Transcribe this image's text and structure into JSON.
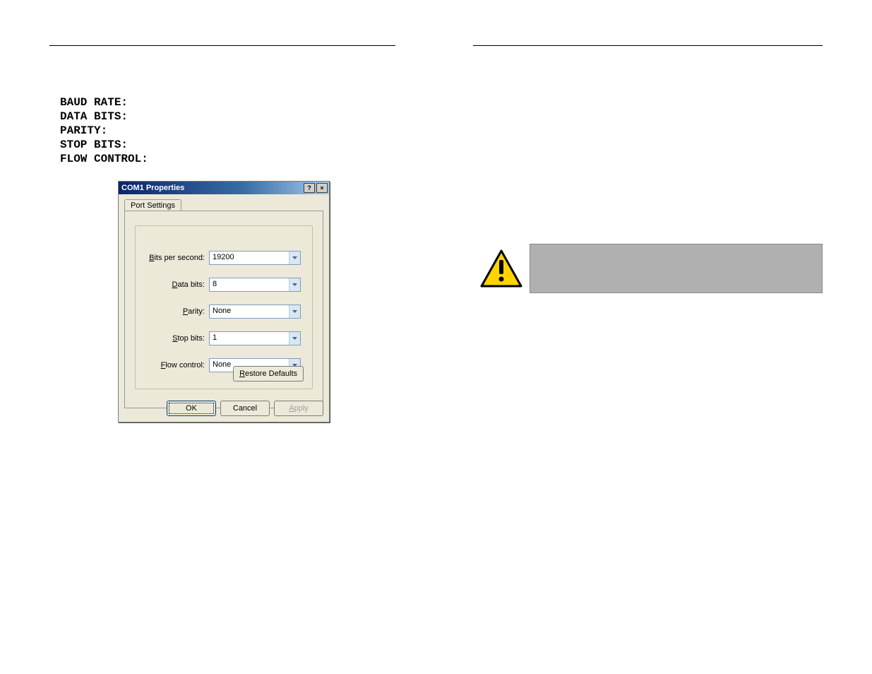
{
  "parameters": {
    "baud_rate_label": "BAUD RATE:",
    "data_bits_label": "DATA BITS:",
    "parity_label": "PARITY:",
    "stop_bits_label": "STOP BITS:",
    "flow_label": "FLOW CONTROL:"
  },
  "dialog": {
    "title": "COM1 Properties",
    "help_btn": "?",
    "close_btn": "×",
    "tab_label": "Port Settings",
    "fields": {
      "bps_label_pre": "B",
      "bps_label_post": "its per second:",
      "bps_value": "19200",
      "databits_label_pre": "D",
      "databits_label_post": "ata bits:",
      "databits_value": "8",
      "parity_label_pre": "P",
      "parity_label_post": "arity:",
      "parity_value": "None",
      "stopbits_label_pre": "S",
      "stopbits_label_post": "top bits:",
      "stopbits_value": "1",
      "flow_label_pre": "F",
      "flow_label_post": "low control:",
      "flow_value": "None"
    },
    "restore_pre": "R",
    "restore_post": "estore Defaults",
    "ok_label": "OK",
    "cancel_label": "Cancel",
    "apply_pre": "A",
    "apply_post": "pply"
  },
  "icons": {
    "chevron_down": "chevron-down-icon",
    "warning": "warning-icon"
  }
}
